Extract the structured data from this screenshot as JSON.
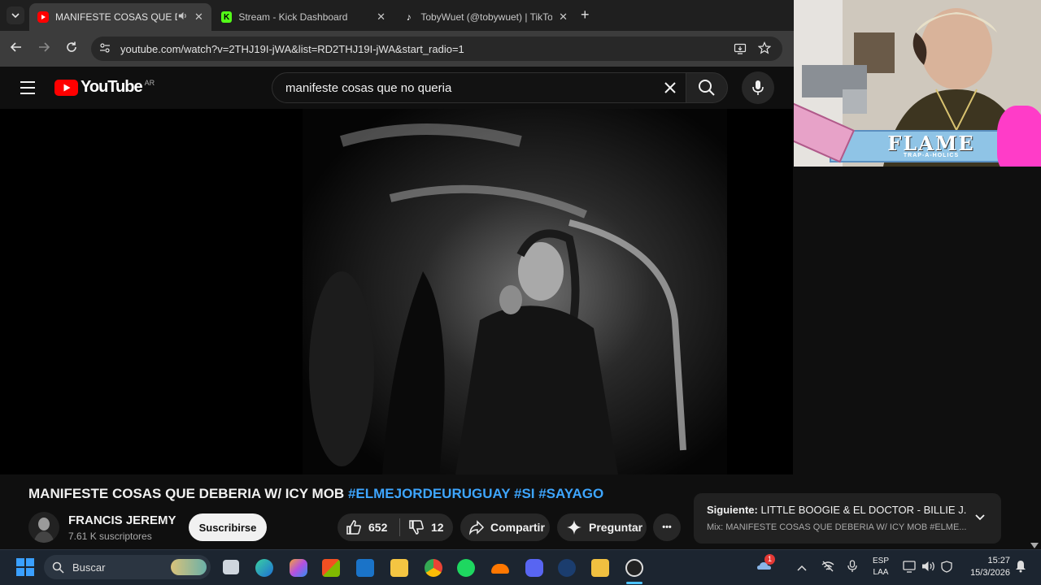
{
  "browser": {
    "tabs": [
      {
        "title": "MANIFESTE COSAS QUE DE",
        "favicon": "youtube-icon",
        "active": true,
        "audio": true
      },
      {
        "title": "Stream - Kick Dashboard",
        "favicon": "kick-icon",
        "active": false
      },
      {
        "title": "TobyWuet (@tobywuet) | TikTok",
        "favicon": "tiktok-icon",
        "active": false
      }
    ],
    "new_tab": "+",
    "url": "youtube.com/watch?v=2THJ19I-jWA&list=RD2THJ19I-jWA&start_radio=1"
  },
  "youtube": {
    "logo_text": "YouTube",
    "region": "AR",
    "search_query": "manifeste cosas que no queria",
    "accent": "#ff0000",
    "link_color": "#3ea6ff"
  },
  "overlay": {
    "flame_text": "FLAME",
    "flame_sub": "TRAP-A-HOLICS"
  },
  "video": {
    "title_main": "MANIFESTE COSAS QUE DEBERIA W/ ICY MOB",
    "hashtags": "#ELMEJORDEURUGUAY #SI #SAYAGO",
    "channel_name": "FRANCIS JEREMY",
    "subscribers": "7.61 K suscriptores",
    "subscribe_label": "Suscribirse",
    "likes": "652",
    "dislikes": "12",
    "share_label": "Compartir",
    "ask_label": "Preguntar",
    "more_label": "•••"
  },
  "up_next": {
    "prefix": "Siguiente:",
    "title": "LITTLE BOOGIE & EL DOCTOR - BILLIE J...",
    "mix": "Mix: MANIFESTE COSAS QUE DEBERIA W/ ICY MOB #ELME..."
  },
  "taskbar": {
    "search_placeholder": "Buscar",
    "lang_top": "ESP",
    "lang_bottom": "LAA",
    "time": "15:27",
    "date": "15/3/2026",
    "weather_badge": "1"
  }
}
